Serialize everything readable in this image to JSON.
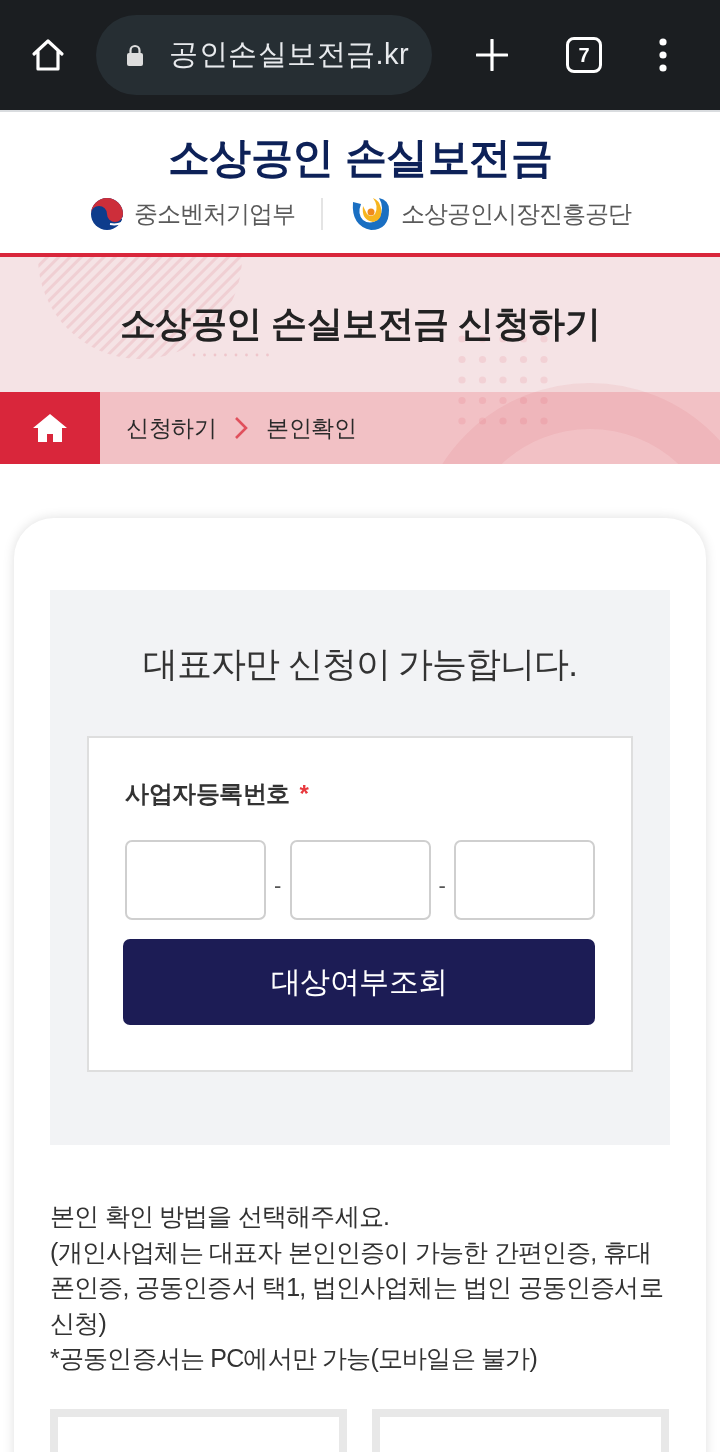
{
  "browser": {
    "url": "공인손실보전금.kr",
    "tab_count": "7"
  },
  "header": {
    "title": "소상공인 손실보전금",
    "agencies": [
      {
        "kind": "ministry",
        "name": "중소벤처기업부"
      },
      {
        "kind": "agency",
        "name": "소상공인시장진흥공단"
      }
    ]
  },
  "banner": {
    "title": "소상공인 손실보전금 신청하기"
  },
  "breadcrumb": [
    "신청하기",
    "본인확인"
  ],
  "eligibility": {
    "notice": "대표자만 신청이 가능합니다.",
    "field_label": "사업자등록번호",
    "required_mark": "*",
    "separators": [
      "-",
      "-"
    ],
    "button": "대상여부조회"
  },
  "instructions": [
    "본인 확인 방법을 선택해주세요.",
    "(개인사업체는 대표자 본인인증이 가능한 간편인증, 휴대폰인증, 공동인증서 택1, 법인사업체는 법인 공동인증서로 신청)",
    "*공동인증서는 PC에서만 가능(모바일은 불가)"
  ]
}
